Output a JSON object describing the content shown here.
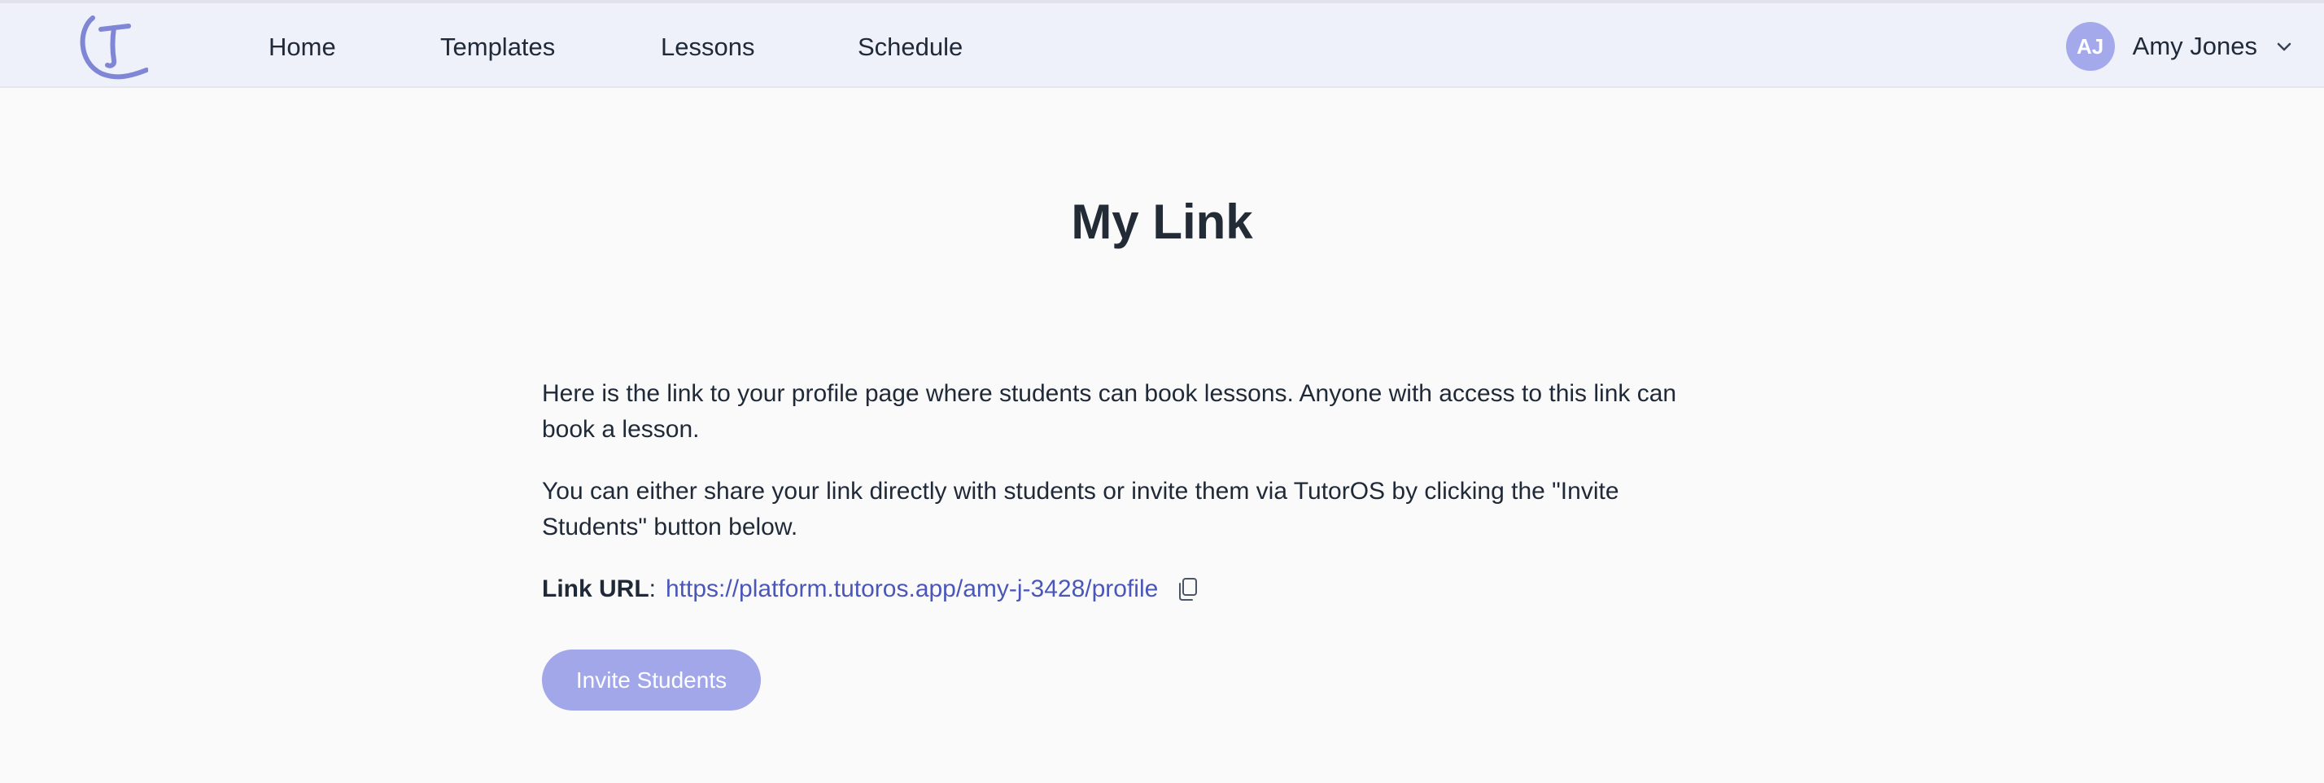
{
  "nav": {
    "items": [
      {
        "label": "Home"
      },
      {
        "label": "Templates"
      },
      {
        "label": "Lessons"
      },
      {
        "label": "Schedule"
      }
    ],
    "logo_letter": "T"
  },
  "user": {
    "initials": "AJ",
    "name": "Amy Jones"
  },
  "page": {
    "title": "My Link",
    "paragraph_1": "Here is the link to your profile page where students can book lessons. Anyone with access to this link can book a lesson.",
    "paragraph_2": "You can either share your link directly with students or invite them via TutorOS by clicking the \"Invite Students\" button below.",
    "link_label": "Link URL",
    "link_colon": ":",
    "link_url": "https://platform.tutoros.app/amy-j-3428/profile",
    "invite_button": "Invite Students"
  },
  "icons": {
    "logo": "tutoros-logo",
    "copy": "copy-icon",
    "chevron": "chevron-down-icon"
  },
  "colors": {
    "accent": "#4b57b8",
    "button": "#a2a7ea",
    "navbar_bg": "#eef0fa",
    "logo": "#7f86d6"
  }
}
